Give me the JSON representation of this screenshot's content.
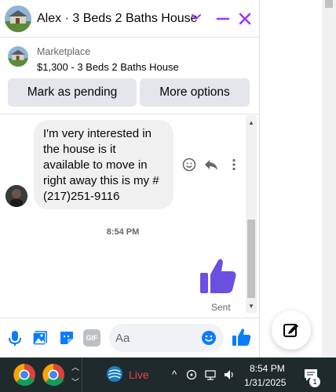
{
  "header": {
    "title": "Alex · 3 Beds 2 Baths House",
    "accent": "#a033ff"
  },
  "listing": {
    "label": "Marketplace",
    "price_title": "$1,300 - 3 Beds 2 Baths House"
  },
  "actions": {
    "pending_label": "Mark as pending",
    "more_label": "More options"
  },
  "conversation": {
    "incoming_message": "I'm very interested in the house is it available to move in right away this is my # (217)251-9116",
    "timestamp": "8:54 PM",
    "sent_status": "Sent",
    "reaction_icons": [
      "emoji-icon",
      "reply-icon",
      "more-dots-icon"
    ]
  },
  "composer": {
    "placeholder": "Aa",
    "icons": [
      "microphone-icon",
      "photo-icon",
      "sticker-icon",
      "gif-icon",
      "emoji-icon",
      "like-icon"
    ],
    "gif_label": "GIF"
  },
  "taskbar": {
    "live_label": "Live",
    "time": "8:54 PM",
    "date": "1/31/2025",
    "notification_count": "1"
  },
  "colors": {
    "messenger_blue": "#0a7cff",
    "like_purple": "#6b4fe0",
    "taskbar_bg": "#1f2a2c",
    "live_red": "#e8404a"
  }
}
